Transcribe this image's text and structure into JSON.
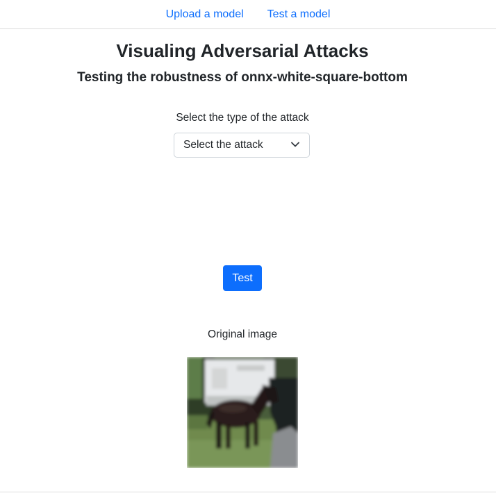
{
  "nav": {
    "links": [
      {
        "label": "Upload a model"
      },
      {
        "label": "Test a model"
      }
    ],
    "link_color": "#0d6efd"
  },
  "header": {
    "title": "Visualing Adversarial Attacks",
    "subtitle": "Testing the robustness of onnx-white-square-bottom"
  },
  "attack_form": {
    "label": "Select the type of the attack",
    "select_value": "Select the attack",
    "chevron_icon": "chevron-down-icon"
  },
  "actions": {
    "test_label": "Test",
    "accent_color": "#0d6efd"
  },
  "result": {
    "caption": "Original image"
  }
}
